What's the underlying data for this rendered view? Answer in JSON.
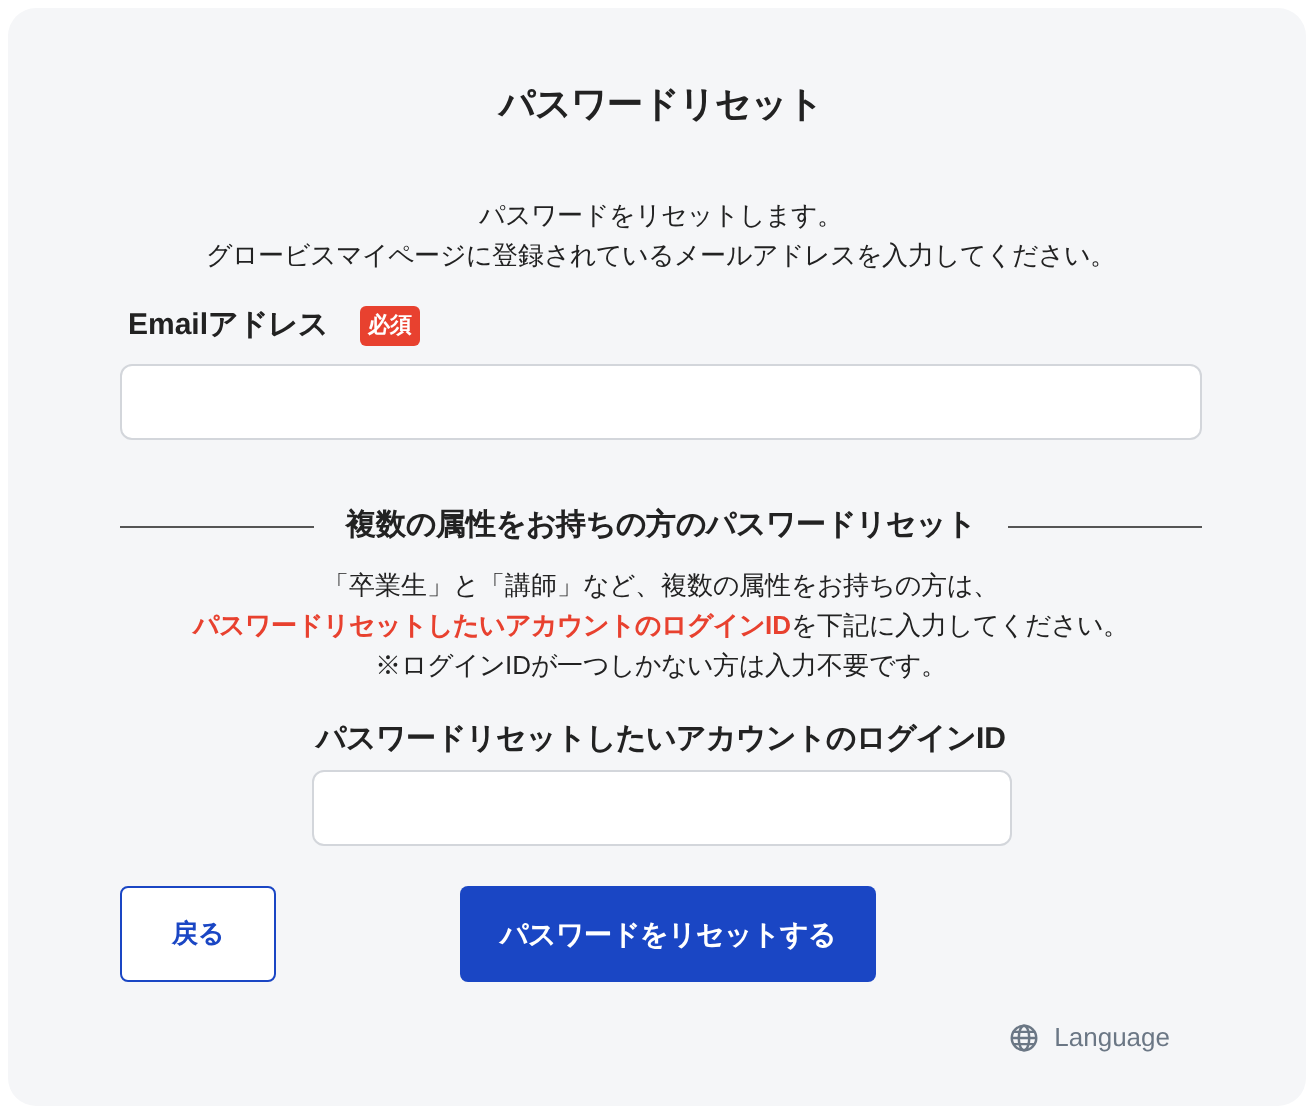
{
  "title": "パスワードリセット",
  "intro": [
    "パスワードをリセットします。",
    "グロービスマイページに登録されているメールアドレスを入力してください。"
  ],
  "email": {
    "label": "Emailアドレス",
    "required_badge": "必須"
  },
  "section": {
    "heading": "複数の属性をお持ちの方のパスワードリセット",
    "note": [
      "「卒業生」と「講師」など、複数の属性をお持ちの方は、",
      "**パスワードリセットしたいアカウントのログインID**を下記に入力してください。",
      "※ログインIDが一つしかない方は入力不要です。"
    ],
    "login_id": {
      "label": "パスワードリセットしたいアカウントのログインID"
    }
  },
  "buttons": [
    {
      "label": "戻る",
      "kind": "secondary"
    },
    {
      "label": "パスワードをリセットする",
      "kind": "primary"
    }
  ],
  "language": "Language"
}
